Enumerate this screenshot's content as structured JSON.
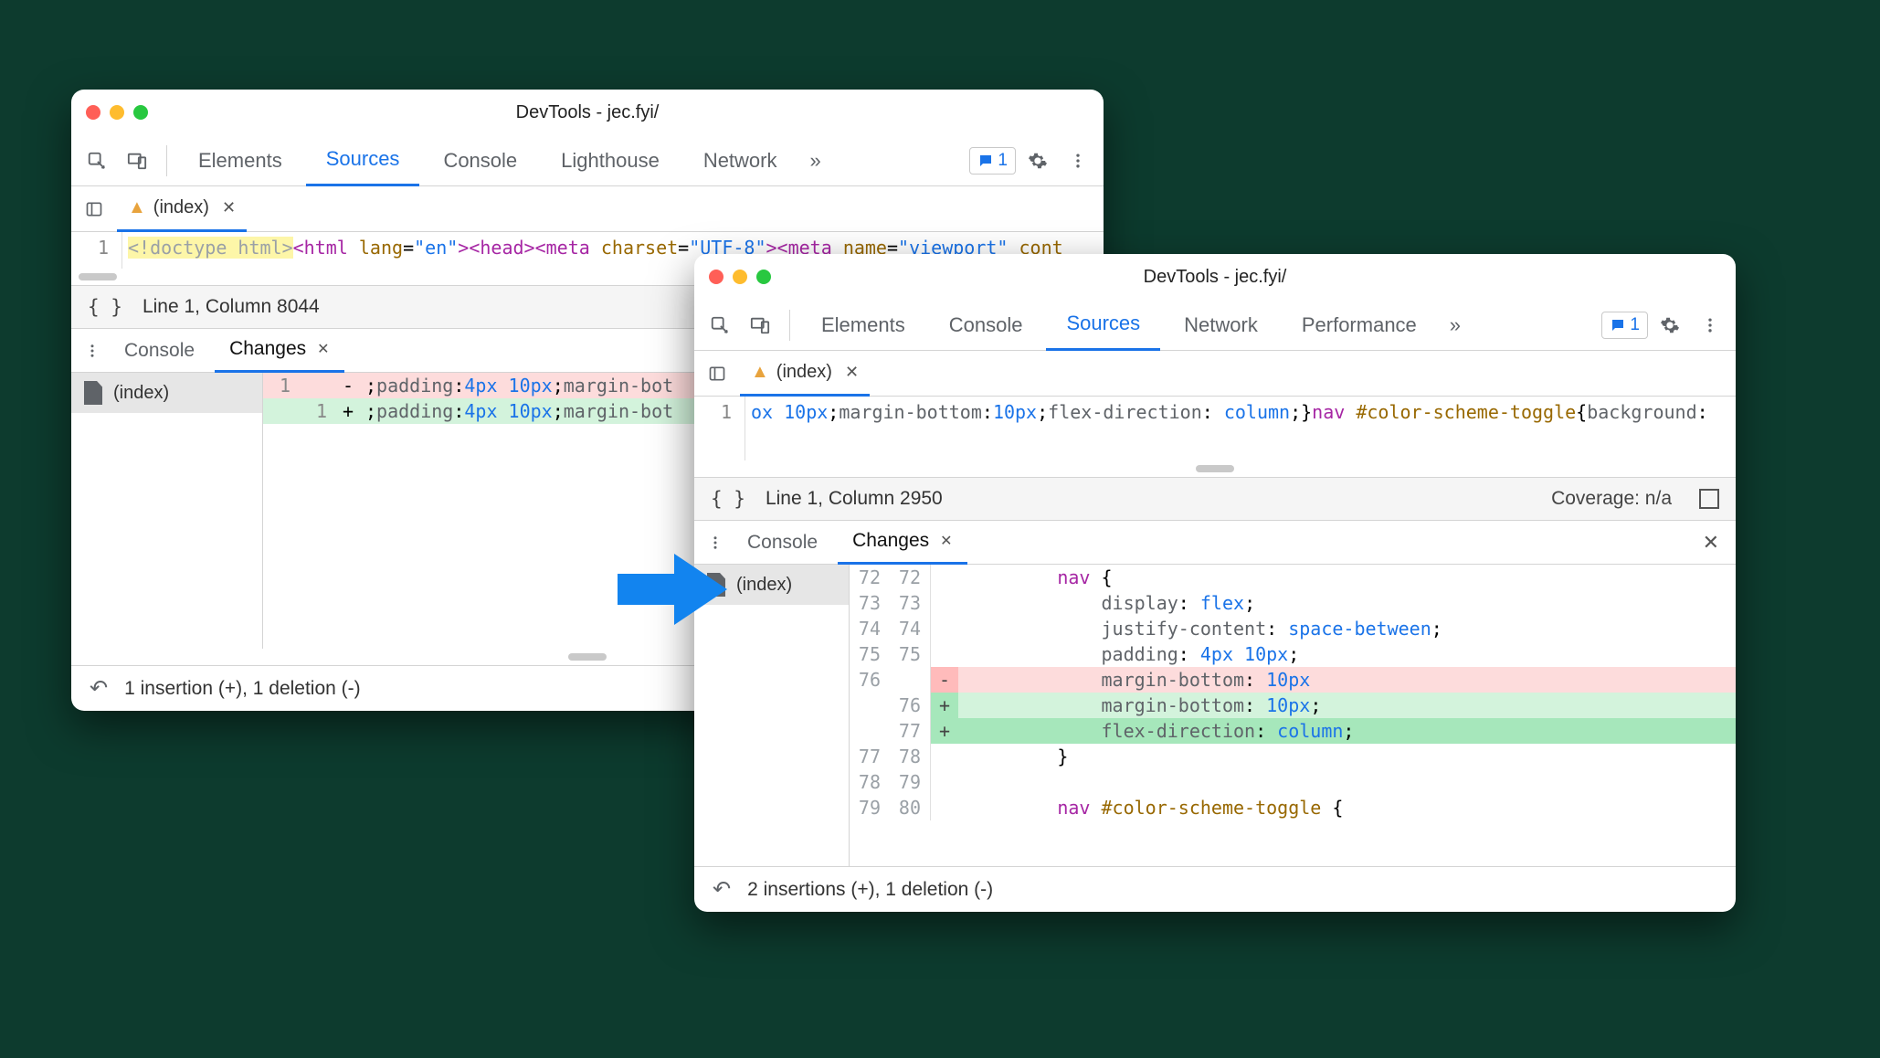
{
  "title": "DevTools - jec.fyi/",
  "badge_count": "1",
  "panel_tabs": {
    "a": [
      "Elements",
      "Sources",
      "Console",
      "Lighthouse",
      "Network"
    ],
    "b": [
      "Elements",
      "Console",
      "Sources",
      "Network",
      "Performance"
    ]
  },
  "file_tab": "(index)",
  "code_a": {
    "line_no": "1",
    "tokens": [
      {
        "t": "<!doctype html>",
        "cls": "hl-y"
      },
      {
        "t": "<",
        "cls": "tok-tag"
      },
      {
        "t": "html ",
        "cls": "tok-tag"
      },
      {
        "t": "lang",
        "cls": "tok-attr"
      },
      {
        "t": "=",
        "cls": ""
      },
      {
        "t": "\"en\"",
        "cls": "tok-str"
      },
      {
        "t": ">",
        "cls": "tok-tag"
      },
      {
        "t": "<",
        "cls": "tok-tag"
      },
      {
        "t": "head",
        "cls": "tok-tag"
      },
      {
        "t": ">",
        "cls": "tok-tag"
      },
      {
        "t": "<",
        "cls": "tok-tag"
      },
      {
        "t": "meta ",
        "cls": "tok-tag"
      },
      {
        "t": "charset",
        "cls": "tok-attr"
      },
      {
        "t": "=",
        "cls": ""
      },
      {
        "t": "\"UTF-8\"",
        "cls": "tok-str"
      },
      {
        "t": ">",
        "cls": "tok-tag"
      },
      {
        "t": "<",
        "cls": "tok-tag"
      },
      {
        "t": "meta ",
        "cls": "tok-tag"
      },
      {
        "t": "name",
        "cls": "tok-attr"
      },
      {
        "t": "=",
        "cls": ""
      },
      {
        "t": "\"viewport\"",
        "cls": "tok-str"
      },
      {
        "t": " cont",
        "cls": "tok-attr"
      }
    ]
  },
  "code_b": {
    "line_no": "1",
    "tokens": [
      {
        "t": "ox ",
        "cls": "tok-val"
      },
      {
        "t": "10px",
        "cls": "tok-val"
      },
      {
        "t": ";",
        "cls": ""
      },
      {
        "t": "margin-bottom",
        "cls": "tok-prop"
      },
      {
        "t": ":",
        "cls": ""
      },
      {
        "t": "10px",
        "cls": "tok-val"
      },
      {
        "t": ";",
        "cls": ""
      },
      {
        "t": "flex-direction",
        "cls": "tok-prop"
      },
      {
        "t": ": ",
        "cls": ""
      },
      {
        "t": "column",
        "cls": "tok-val"
      },
      {
        "t": ";}",
        "cls": ""
      },
      {
        "t": "nav ",
        "cls": "tok-sel"
      },
      {
        "t": "#color-scheme-toggle",
        "cls": "tok-id"
      },
      {
        "t": "{",
        "cls": ""
      },
      {
        "t": "background",
        "cls": "tok-prop"
      },
      {
        "t": ":",
        "cls": ""
      }
    ]
  },
  "status_a": "Line 1, Column 8044",
  "status_b": "Line 1, Column 2950",
  "coverage": "Coverage: n/a",
  "drawer_tabs": {
    "console": "Console",
    "changes": "Changes"
  },
  "sidebar_file": "(index)",
  "simple_diff": [
    {
      "a": "",
      "b": "1",
      "m": "-",
      "bg": "bg-del",
      "ind": 0,
      "toks": [
        {
          "t": ";",
          "cls": ""
        },
        {
          "t": "padding",
          "cls": "tok-prop"
        },
        {
          "t": ":",
          "cls": ""
        },
        {
          "t": "4px 10px",
          "cls": "tok-val"
        },
        {
          "t": ";",
          "cls": ""
        },
        {
          "t": "margin-bot",
          "cls": "tok-prop"
        }
      ]
    },
    {
      "a": "1",
      "b": "",
      "m": "+",
      "bg": "bg-add",
      "ind": 0,
      "toks": [
        {
          "t": ";",
          "cls": ""
        },
        {
          "t": "padding",
          "cls": "tok-prop"
        },
        {
          "t": ":",
          "cls": ""
        },
        {
          "t": "4px 10px",
          "cls": "tok-val"
        },
        {
          "t": ";",
          "cls": ""
        },
        {
          "t": "margin-bot",
          "cls": "tok-prop"
        }
      ]
    }
  ],
  "diff_b": [
    {
      "a": "72",
      "b": "72",
      "m": "",
      "bg": "",
      "ind": 8,
      "toks": [
        {
          "t": "nav ",
          "cls": "tok-sel"
        },
        {
          "t": "{",
          "cls": ""
        }
      ]
    },
    {
      "a": "73",
      "b": "73",
      "m": "",
      "bg": "",
      "ind": 12,
      "toks": [
        {
          "t": "display",
          "cls": "tok-prop"
        },
        {
          "t": ": ",
          "cls": ""
        },
        {
          "t": "flex",
          "cls": "tok-val"
        },
        {
          "t": ";",
          "cls": ""
        }
      ]
    },
    {
      "a": "74",
      "b": "74",
      "m": "",
      "bg": "",
      "ind": 12,
      "toks": [
        {
          "t": "justify-content",
          "cls": "tok-prop"
        },
        {
          "t": ": ",
          "cls": ""
        },
        {
          "t": "space-between",
          "cls": "tok-val"
        },
        {
          "t": ";",
          "cls": ""
        }
      ]
    },
    {
      "a": "75",
      "b": "75",
      "m": "",
      "bg": "",
      "ind": 12,
      "toks": [
        {
          "t": "padding",
          "cls": "tok-prop"
        },
        {
          "t": ": ",
          "cls": ""
        },
        {
          "t": "4px 10px",
          "cls": "tok-val"
        },
        {
          "t": ";",
          "cls": ""
        }
      ]
    },
    {
      "a": "76",
      "b": "",
      "m": "-",
      "bg": "bg-del",
      "mb": "bg-del-strong",
      "ind": 12,
      "toks": [
        {
          "t": "margin-bottom",
          "cls": "tok-prop"
        },
        {
          "t": ": ",
          "cls": ""
        },
        {
          "t": "10px",
          "cls": "tok-val"
        }
      ]
    },
    {
      "a": "",
      "b": "76",
      "m": "+",
      "bg": "bg-add",
      "mb": "bg-add-strong",
      "ind": 12,
      "toks": [
        {
          "t": "margin-bottom",
          "cls": "tok-prop"
        },
        {
          "t": ": ",
          "cls": ""
        },
        {
          "t": "10px",
          "cls": "tok-val"
        },
        {
          "t": ";",
          "cls": ""
        }
      ]
    },
    {
      "a": "",
      "b": "77",
      "m": "+",
      "bg": "bg-add",
      "mb": "bg-add-strong",
      "ind": 12,
      "code_bg": "bg-add-strong",
      "toks": [
        {
          "t": "flex-direction",
          "cls": "tok-prop"
        },
        {
          "t": ": ",
          "cls": ""
        },
        {
          "t": "column",
          "cls": "tok-val"
        },
        {
          "t": ";",
          "cls": ""
        }
      ]
    },
    {
      "a": "77",
      "b": "78",
      "m": "",
      "bg": "",
      "ind": 8,
      "toks": [
        {
          "t": "}",
          "cls": ""
        }
      ]
    },
    {
      "a": "78",
      "b": "79",
      "m": "",
      "bg": "",
      "ind": 0,
      "toks": []
    },
    {
      "a": "79",
      "b": "80",
      "m": "",
      "bg": "",
      "ind": 8,
      "toks": [
        {
          "t": "nav ",
          "cls": "tok-sel"
        },
        {
          "t": "#color-scheme-toggle",
          "cls": "tok-id"
        },
        {
          "t": " {",
          "cls": ""
        }
      ]
    }
  ],
  "footer_a": "1 insertion (+), 1 deletion (-)",
  "footer_b": "2 insertions (+), 1 deletion (-)"
}
